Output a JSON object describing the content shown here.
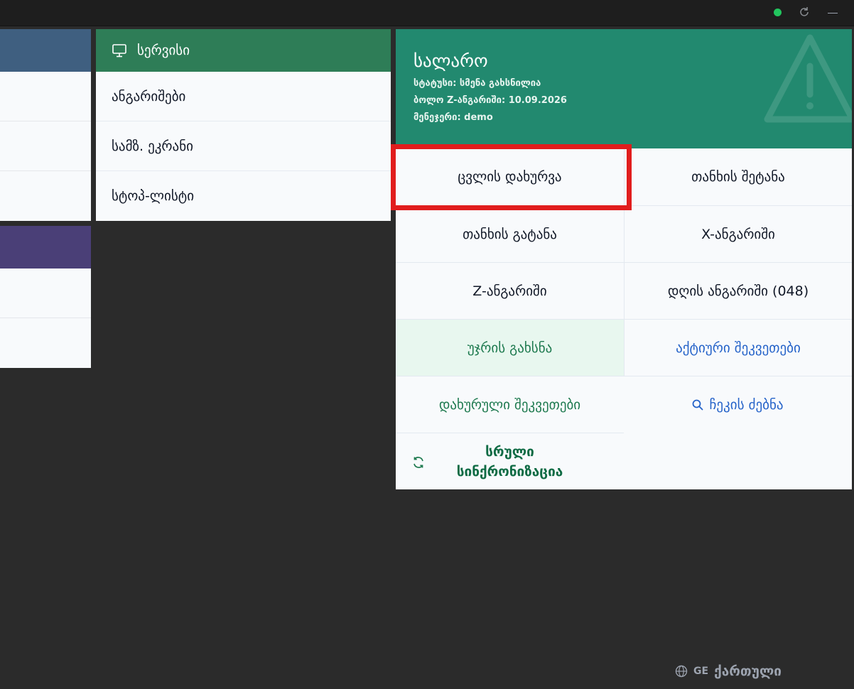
{
  "titlebar": {
    "status_color": "#22c55e",
    "icons": [
      "status-dot",
      "refresh-icon",
      "minimize-icon"
    ]
  },
  "left_panels": {
    "top_header_color": "#3f5f80",
    "bottom_header_color": "#4a3f77"
  },
  "service": {
    "title": "სერვისი",
    "icon": "monitor-icon",
    "header_color": "#2e7d57",
    "items": [
      {
        "label": "ანგარიშები"
      },
      {
        "label": "სამზ. ეკრანი"
      },
      {
        "label": "სტოპ-ლისტი"
      }
    ]
  },
  "cashier": {
    "title": "სალარო",
    "status": "სტატუსი: სმენა გახსნილია",
    "last_z": "ბოლო Z-ანგარიში: 10.09.2026",
    "manager": "მენეჯერი: demo",
    "header_color": "#22896f",
    "background_icon": "warning-triangle-icon",
    "buttons": {
      "close_shift": "ცვლის დახურვა",
      "cash_in": "თანხის შეტანა",
      "cash_out": "თანხის გატანა",
      "x_report": "X-ანგარიში",
      "z_report": "Z-ანგარიში",
      "day_report": "დღის ანგარიში (048)",
      "open_drawer": "უჯრის გახსნა",
      "active_orders": "აქტიური შეკვეთები",
      "closed_orders": "დახურული შეკვეთები",
      "search_check": "ჩეკის ძებნა",
      "full_sync_line1": "სრული",
      "full_sync_line2": "სინქრონიზაცია"
    },
    "highlight_color": "#e11d1d"
  },
  "language": {
    "code": "GE",
    "name": "ქართული",
    "icon": "globe-icon"
  }
}
